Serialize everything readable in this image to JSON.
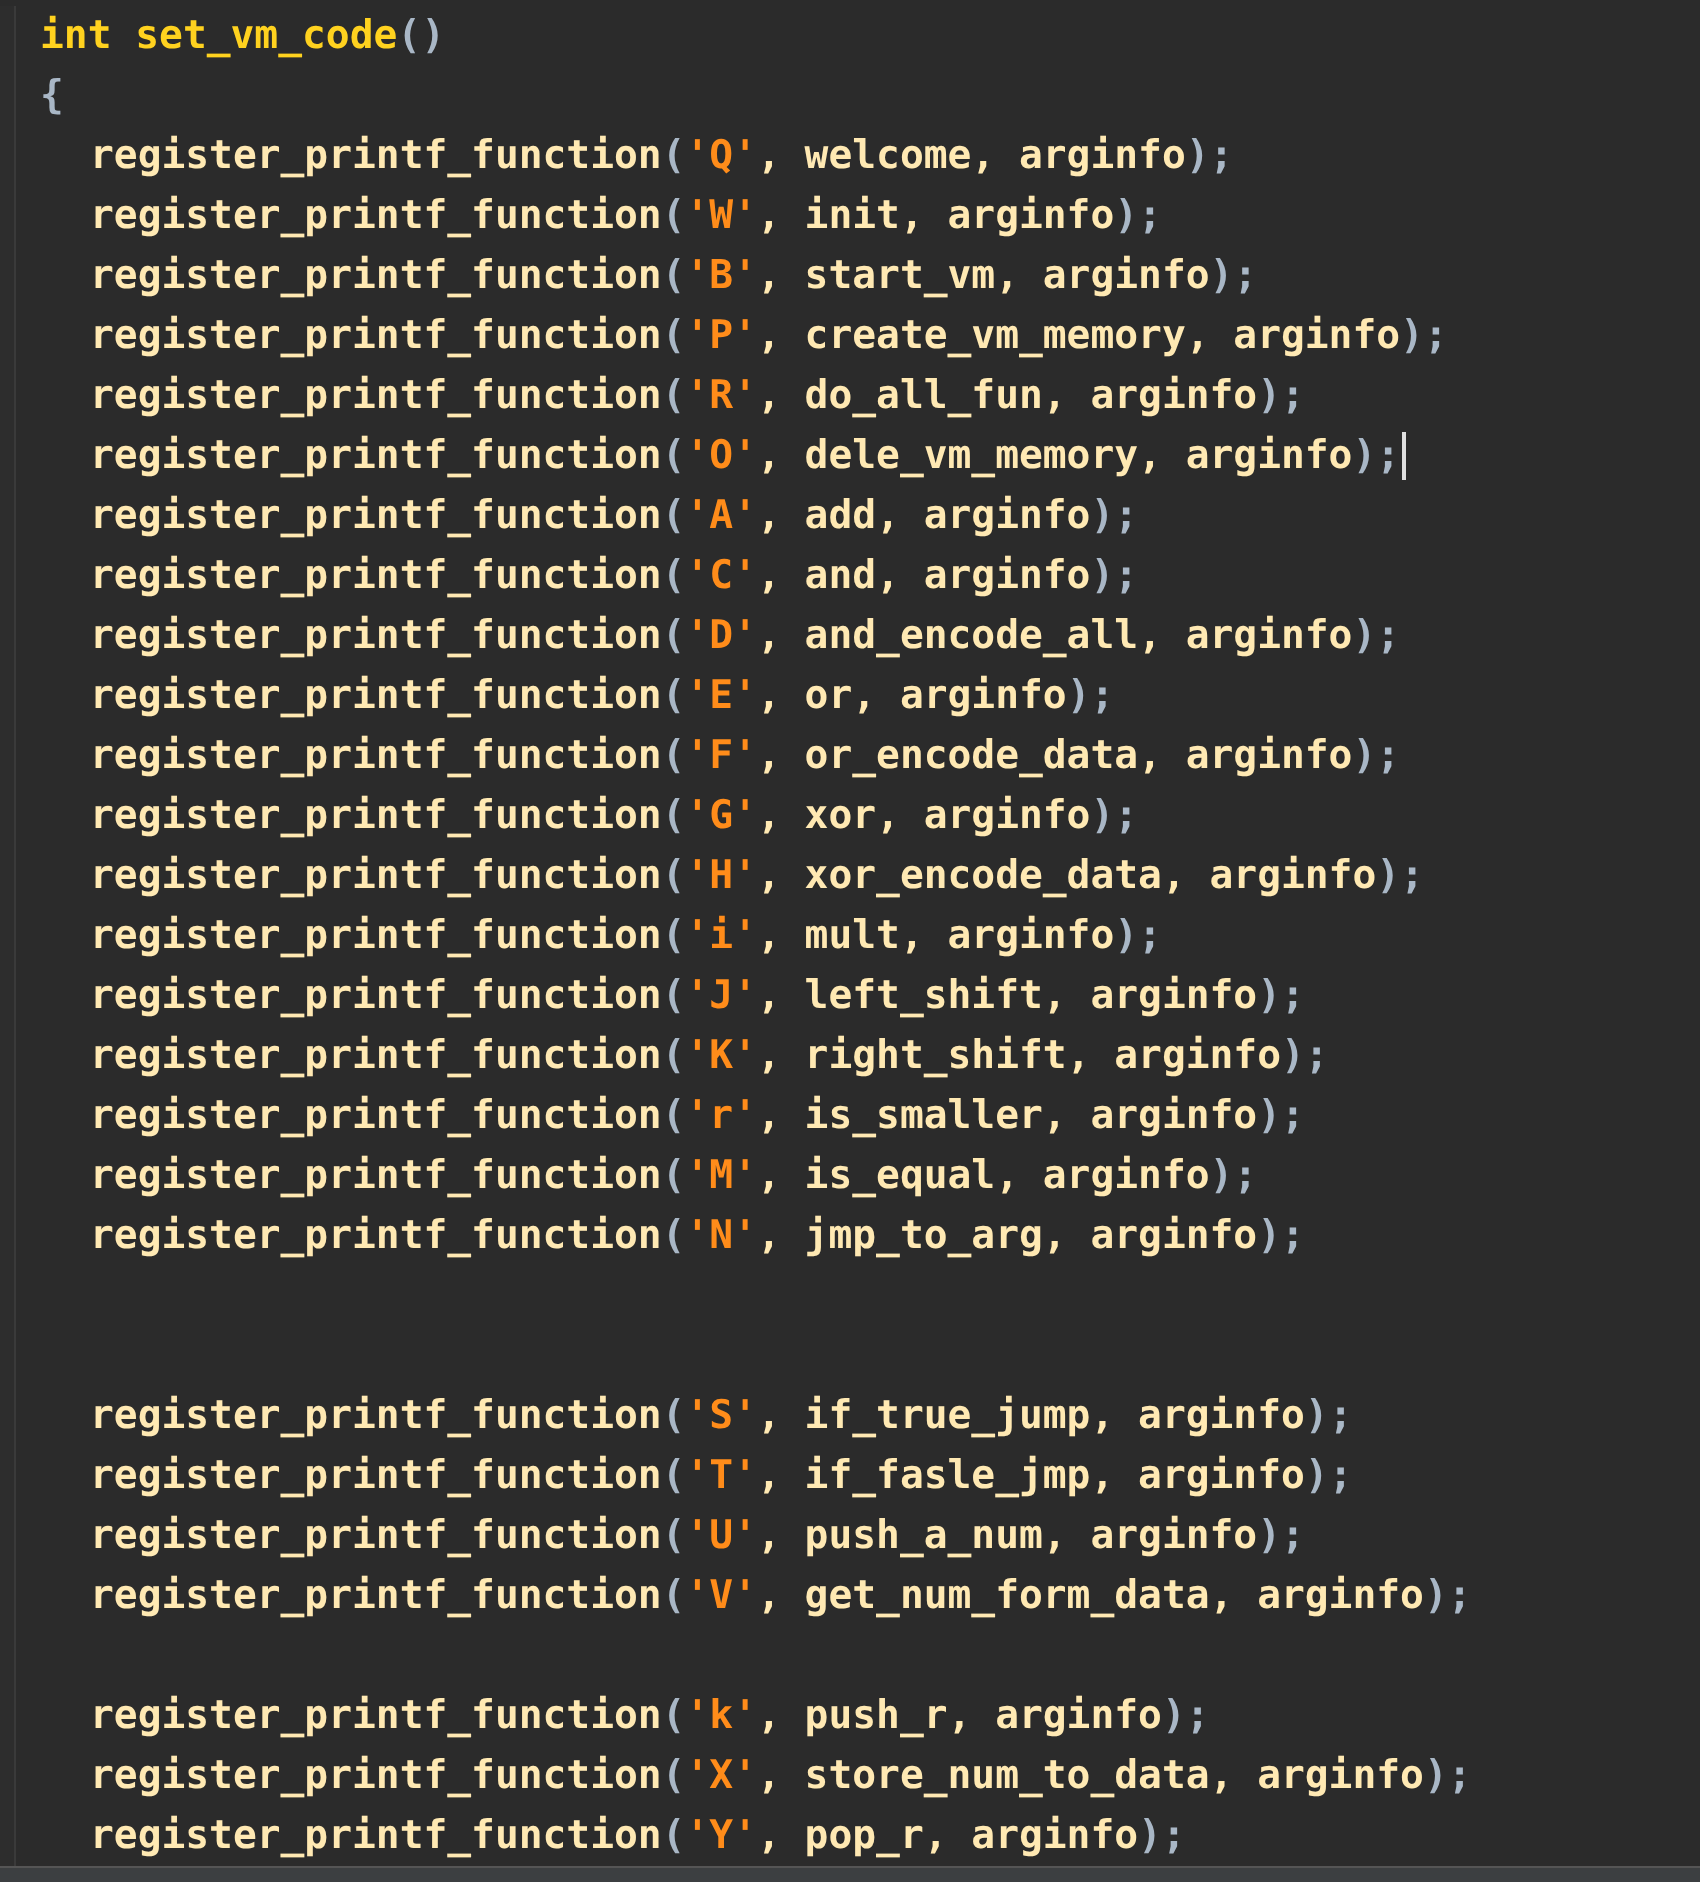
{
  "editor": {
    "lines": [
      {
        "kind": "signature",
        "code": "int set_vm_code()"
      },
      {
        "kind": "brace",
        "code": "{"
      },
      {
        "kind": "call",
        "code": "register_printf_function('Q', welcome, arginfo);",
        "cursor": false
      },
      {
        "kind": "call",
        "code": "register_printf_function('W', init, arginfo);",
        "cursor": false
      },
      {
        "kind": "call",
        "code": "register_printf_function('B', start_vm, arginfo);",
        "cursor": false
      },
      {
        "kind": "call",
        "code": "register_printf_function('P', create_vm_memory, arginfo);",
        "cursor": false
      },
      {
        "kind": "call",
        "code": "register_printf_function('R', do_all_fun, arginfo);",
        "cursor": false
      },
      {
        "kind": "call",
        "code": "register_printf_function('O', dele_vm_memory, arginfo);",
        "cursor": true
      },
      {
        "kind": "call",
        "code": "register_printf_function('A', add, arginfo);",
        "cursor": false
      },
      {
        "kind": "call",
        "code": "register_printf_function('C', and, arginfo);",
        "cursor": false
      },
      {
        "kind": "call",
        "code": "register_printf_function('D', and_encode_all, arginfo);",
        "cursor": false
      },
      {
        "kind": "call",
        "code": "register_printf_function('E', or, arginfo);",
        "cursor": false
      },
      {
        "kind": "call",
        "code": "register_printf_function('F', or_encode_data, arginfo);",
        "cursor": false
      },
      {
        "kind": "call",
        "code": "register_printf_function('G', xor, arginfo);",
        "cursor": false
      },
      {
        "kind": "call",
        "code": "register_printf_function('H', xor_encode_data, arginfo);",
        "cursor": false
      },
      {
        "kind": "call",
        "code": "register_printf_function('i', mult, arginfo);",
        "cursor": false
      },
      {
        "kind": "call",
        "code": "register_printf_function('J', left_shift, arginfo);",
        "cursor": false
      },
      {
        "kind": "call",
        "code": "register_printf_function('K', right_shift, arginfo);",
        "cursor": false
      },
      {
        "kind": "call",
        "code": "register_printf_function('r', is_smaller, arginfo);",
        "cursor": false
      },
      {
        "kind": "call",
        "code": "register_printf_function('M', is_equal, arginfo);",
        "cursor": false
      },
      {
        "kind": "call",
        "code": "register_printf_function('N', jmp_to_arg, arginfo);",
        "cursor": false
      },
      {
        "kind": "blank"
      },
      {
        "kind": "blank"
      },
      {
        "kind": "call",
        "code": "register_printf_function('S', if_true_jump, arginfo);",
        "cursor": false
      },
      {
        "kind": "call",
        "code": "register_printf_function('T', if_fasle_jmp, arginfo);",
        "cursor": false
      },
      {
        "kind": "call",
        "code": "register_printf_function('U', push_a_num, arginfo);",
        "cursor": false
      },
      {
        "kind": "call",
        "code": "register_printf_function('V', get_num_form_data, arginfo);",
        "cursor": false
      },
      {
        "kind": "blank"
      },
      {
        "kind": "call",
        "code": "register_printf_function('k', push_r, arginfo);",
        "cursor": false
      },
      {
        "kind": "call",
        "code": "register_printf_function('X', store_num_to_data, arginfo);",
        "cursor": false
      },
      {
        "kind": "call",
        "code": "register_printf_function('Y', pop_r, arginfo);",
        "cursor": false
      }
    ]
  }
}
